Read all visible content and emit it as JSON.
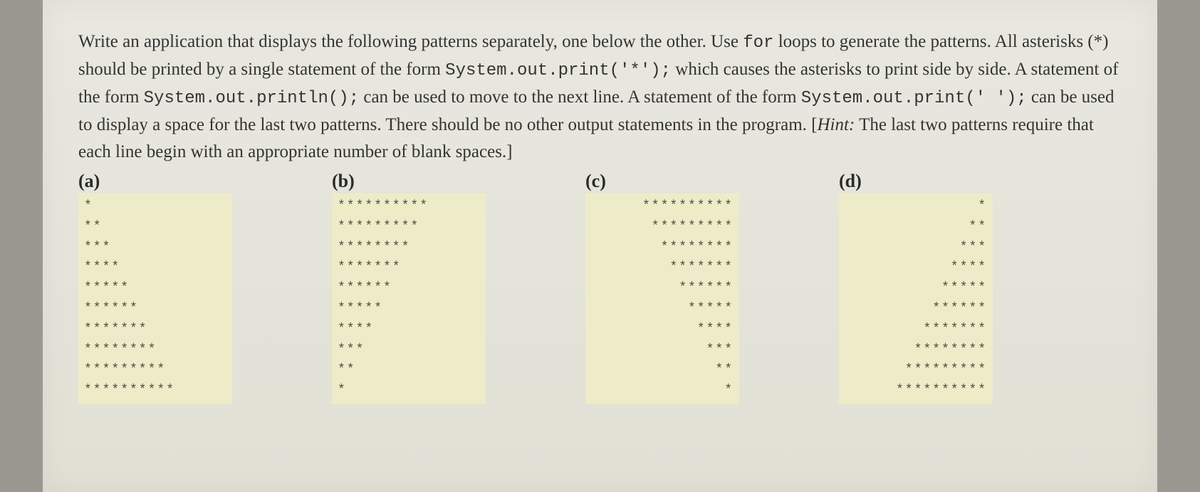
{
  "question": {
    "part1": "Write an application that displays the following patterns separately, one below the other. Use ",
    "code1": "for",
    "part2": " loops to generate the patterns. All asterisks (*) should be printed by a single statement of the form ",
    "code2": "System.out.print('*');",
    "part3": " which causes the asterisks to print side by side. A statement of the form ",
    "code3": "System.out.println();",
    "part4": " can be used to move to the next line. A statement of the form ",
    "code4": "System.out.print(' ');",
    "part5": " can be used to display a space for the last two patterns. There should be no other output statements in the program. [",
    "hint_label": "Hint:",
    "hint_text": " The last two patterns require that each line begin with an appropriate number of blank spaces.]"
  },
  "patterns": [
    {
      "label": "(a)",
      "align": "left",
      "lines": [
        "*",
        "**",
        "***",
        "****",
        "*****",
        "******",
        "*******",
        "********",
        "*********",
        "**********"
      ]
    },
    {
      "label": "(b)",
      "align": "left",
      "lines": [
        "**********",
        "*********",
        "********",
        "*******",
        "******",
        "*****",
        "****",
        "***",
        "**",
        "*"
      ]
    },
    {
      "label": "(c)",
      "align": "right",
      "lines": [
        "**********",
        "*********",
        "********",
        "*******",
        "******",
        "*****",
        "****",
        "***",
        "**",
        "*"
      ]
    },
    {
      "label": "(d)",
      "align": "right",
      "lines": [
        "*",
        "**",
        "***",
        "****",
        "*****",
        "******",
        "*******",
        "********",
        "*********",
        "**********"
      ]
    }
  ]
}
